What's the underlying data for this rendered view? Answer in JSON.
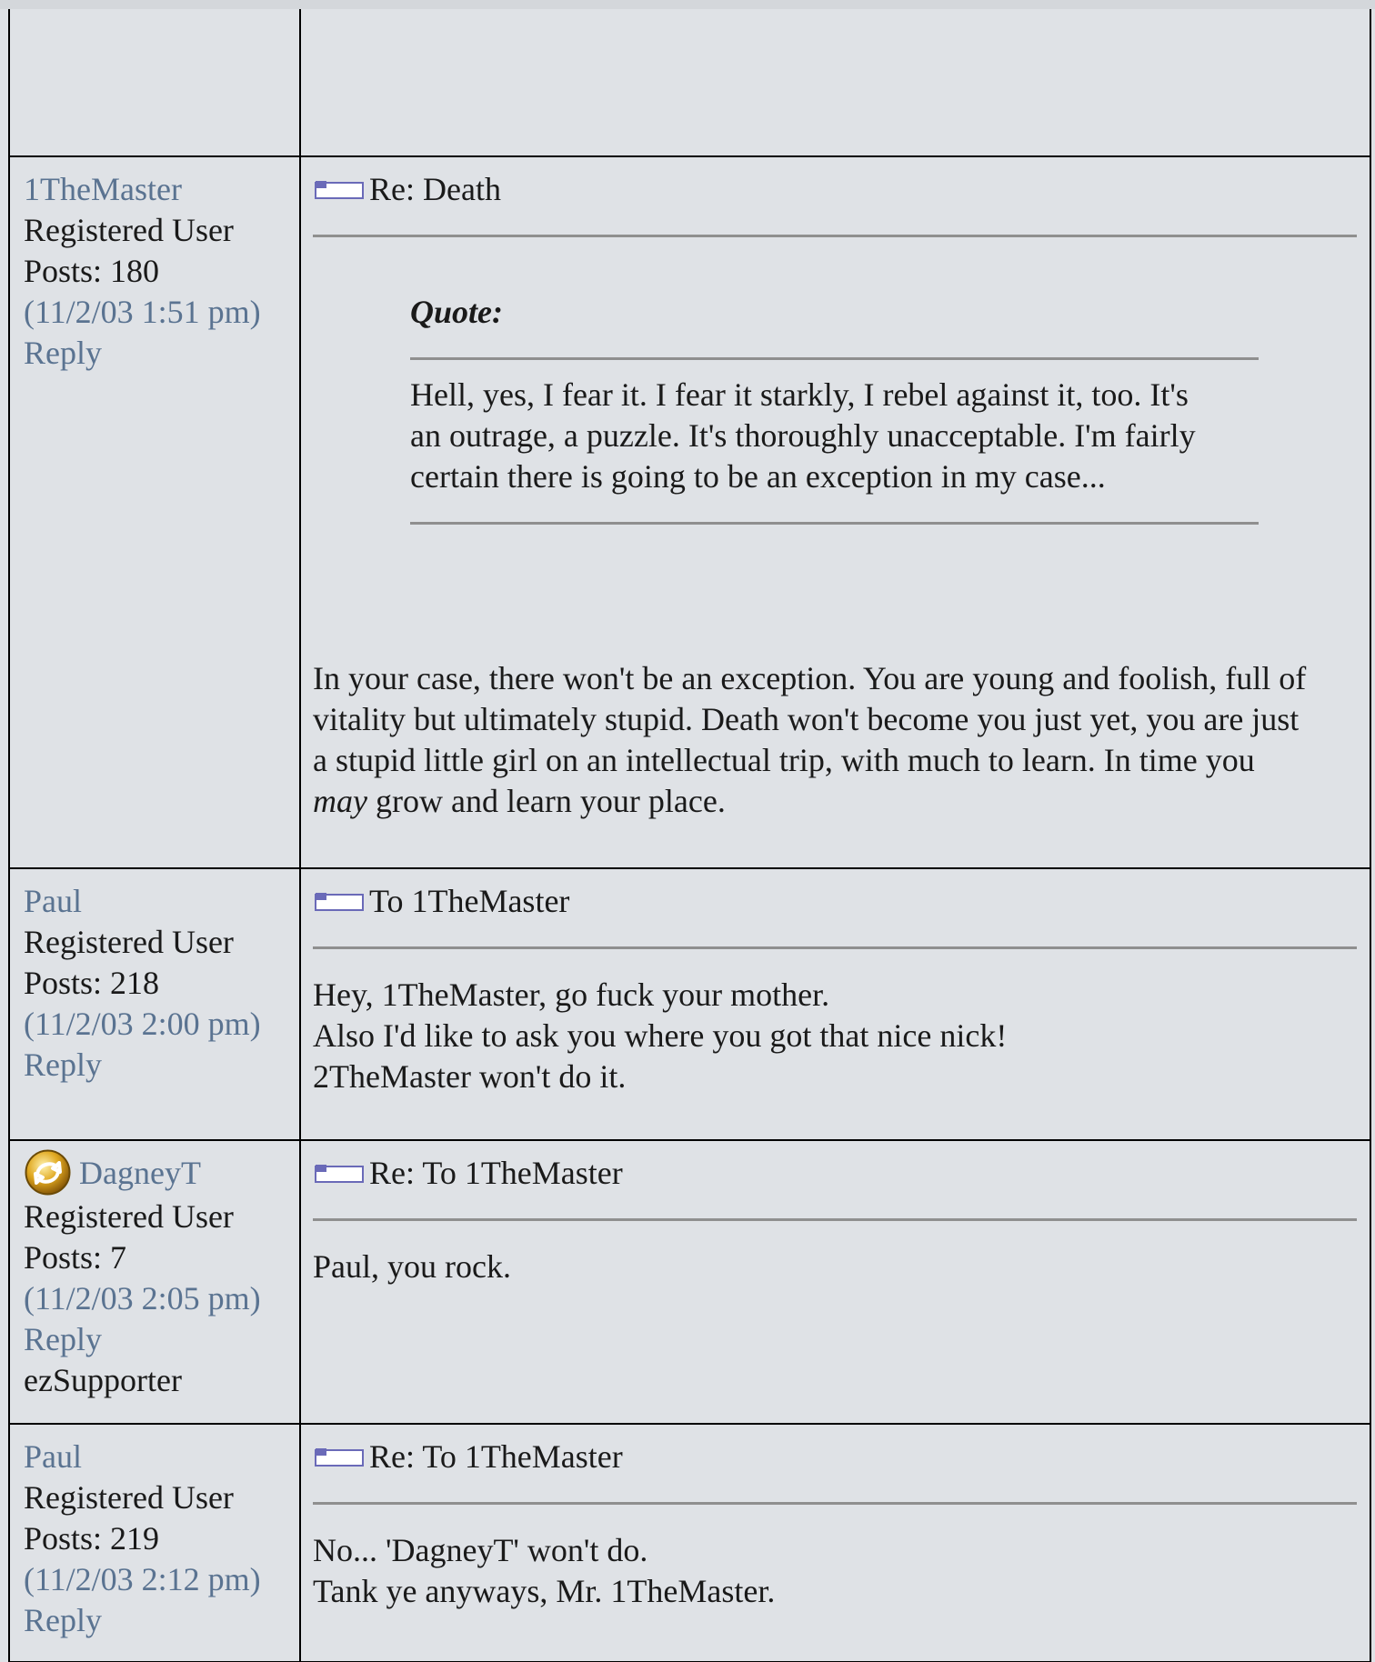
{
  "posts": [
    {
      "author": "1TheMaster",
      "role": "Registered User",
      "posts": "Posts: 180",
      "date": "(11/2/03 1:51 pm)",
      "reply": "Reply",
      "subject": "Re: Death",
      "quote_label": "Quote:",
      "quote_lines": [
        "Hell, yes, I fear it. I fear it starkly, I rebel against it, too. It's",
        "an outrage, a puzzle. It's thoroughly unacceptable. I'm fairly",
        "certain there is going to be an exception in my case..."
      ],
      "body_lines": [
        "In your case, there won't be an exception. You are young and foolish, full of",
        "vitality but ultimately stupid. Death won't become you just yet, you are just",
        "a stupid little girl on an intellectual trip, with much to learn. In time you"
      ],
      "body_last_em": "may",
      "body_last_rest": " grow and learn your place."
    },
    {
      "author": "Paul",
      "role": "Registered User",
      "posts": "Posts: 218",
      "date": "(11/2/03 2:00 pm)",
      "reply": "Reply",
      "subject": "To 1TheMaster",
      "body_lines": [
        "Hey, 1TheMaster, go fuck your mother.",
        "Also I'd like to ask you where you got that nice nick!",
        "2TheMaster won't do it."
      ]
    },
    {
      "author": "DagneyT",
      "role": "Registered User",
      "posts": "Posts: 7",
      "date": "(11/2/03 2:05 pm)",
      "reply": "Reply",
      "extra": "ezSupporter",
      "subject": "Re: To 1TheMaster",
      "body_lines": [
        "Paul, you rock."
      ]
    },
    {
      "author": "Paul",
      "role": "Registered User",
      "posts": "Posts: 219",
      "date": "(11/2/03 2:12 pm)",
      "reply": "Reply",
      "subject": "Re: To 1TheMaster",
      "body_lines": [
        "No... 'DagneyT' won't do.",
        "Tank ye anyways, Mr. 1TheMaster."
      ]
    }
  ],
  "icons": {
    "post_icon": "post-message-icon",
    "avatar": "ezsupporter-badge-icon"
  },
  "colors": {
    "background": "#dfe2e6",
    "link": "#5a7391",
    "border": "#000000",
    "separator": "#8f8f8f",
    "post_icon_accent": "#6a6ab8"
  }
}
